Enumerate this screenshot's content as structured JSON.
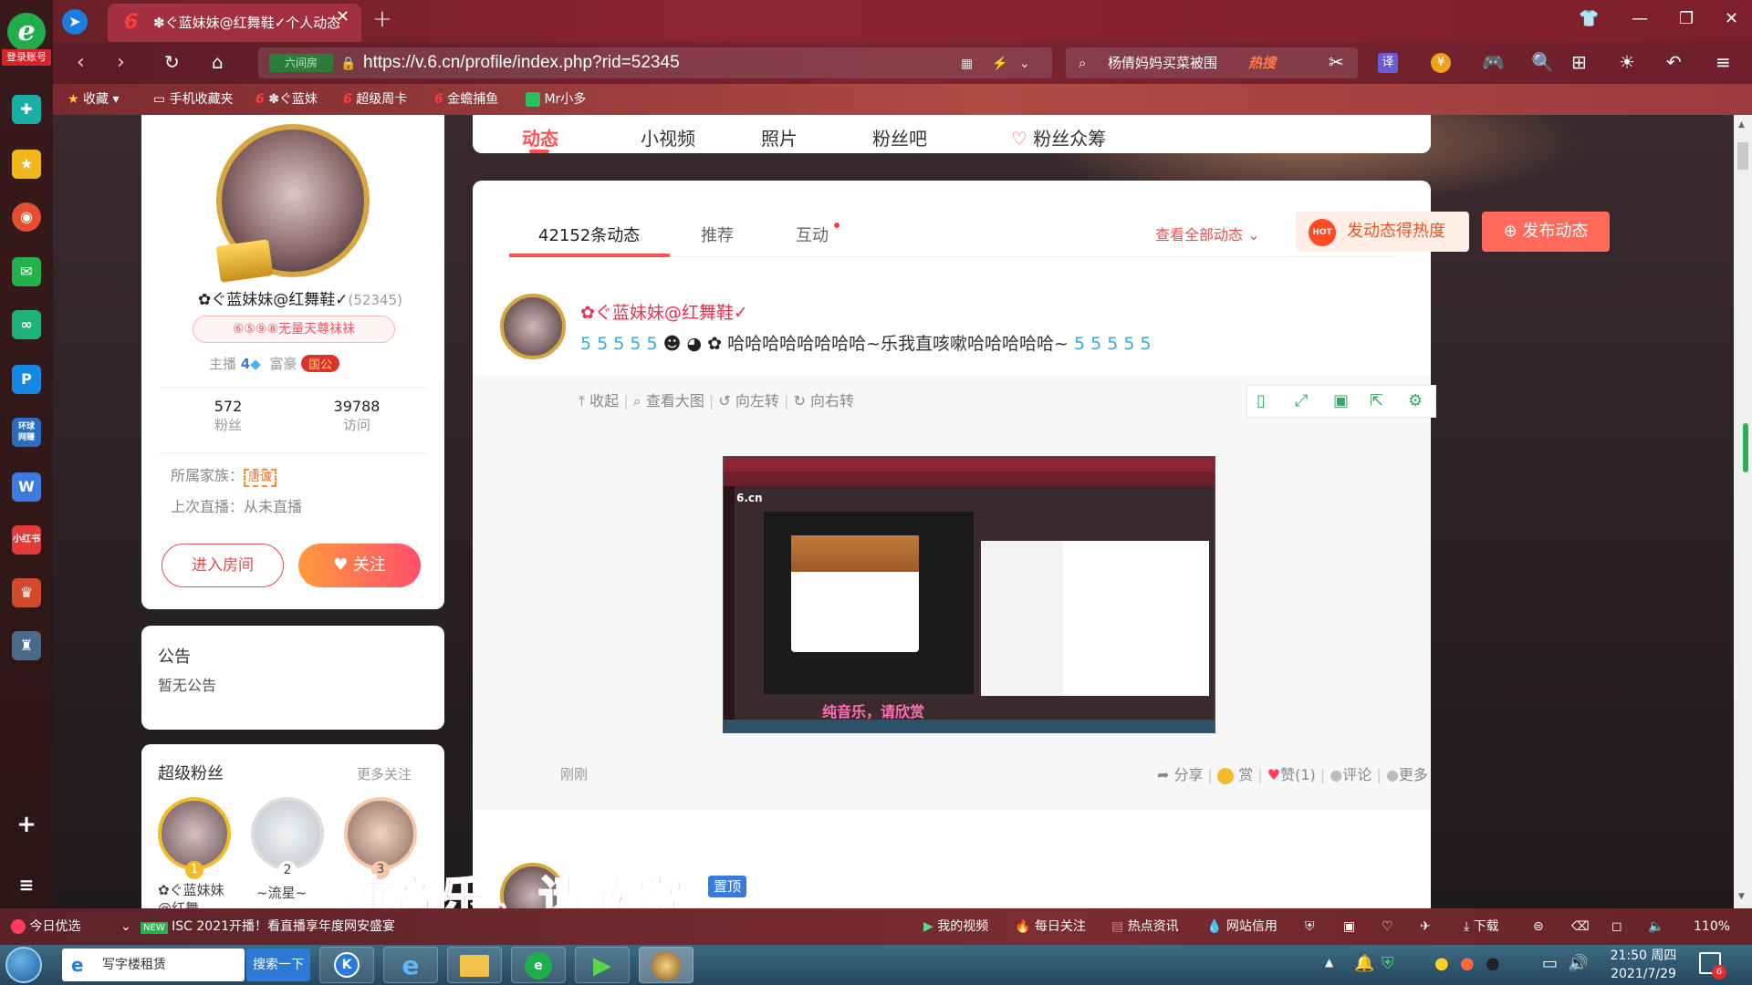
{
  "browser": {
    "login_label": "登录账号",
    "tab_title": "✽ぐ蓝妹妹@红舞鞋✓个人动态",
    "url": "https://v.6.cn/profile/index.php?rid=52345",
    "site_badge": "六间房",
    "search_text": "杨倩妈妈买菜被围",
    "search_hot": "热搜",
    "translate_label": "译",
    "bookmarks": [
      "收藏",
      "手机收藏夹",
      "✽ぐ蓝妹",
      "超级周卡",
      "金蟾捕鱼",
      "Mr小多"
    ]
  },
  "profile_nav": {
    "tabs": [
      "动态",
      "小视频",
      "照片",
      "粉丝吧",
      "粉丝众筹"
    ],
    "active": "动态"
  },
  "profile": {
    "name": "✿ぐ蓝妹妹@红舞鞋✓",
    "rid": "(52345)",
    "badge": "⑥⑤⑨⑧无量天尊袜袜",
    "anchor_label": "主播",
    "anchor_level": "4",
    "rich_label": "富豪",
    "rich_badge": "国公",
    "fans_count": "572",
    "fans_label": "粉丝",
    "visits_count": "39788",
    "visits_label": "访问",
    "family_label": "所属家族：",
    "family_value": "唐诚",
    "last_live": "上次直播：从未直播",
    "enter_room": "进入房间",
    "follow": "关注"
  },
  "notice": {
    "title": "公告",
    "content": "暂无公告"
  },
  "super_fans": {
    "title": "超级粉丝",
    "more": "更多关注",
    "fans": [
      {
        "rank": "1",
        "name": "✿ぐ蓝妹妹@红舞"
      },
      {
        "rank": "2",
        "name": "~流星~"
      },
      {
        "rank": "3",
        "name": ""
      }
    ]
  },
  "feed_header": {
    "count_tab": "42152条动态",
    "recommend_tab": "推荐",
    "interact_tab": "互动",
    "view_all": "查看全部动态",
    "hot_button": "发动态得热度",
    "hot_badge": "HOT",
    "publish_button": "发布动态"
  },
  "post": {
    "author": "✿ぐ蓝妹妹@红舞鞋✓",
    "text": "哈哈哈哈哈哈哈哈~乐我直咳嗽哈哈哈哈哈~",
    "actions": [
      "收起",
      "查看大图",
      "向左转",
      "向右转"
    ],
    "time": "刚刚",
    "footer": [
      "分享",
      "赏",
      "赞(1)",
      "评论",
      "更多"
    ],
    "caption": "纯音乐，请欣赏",
    "screenshot_cn": "6.cn"
  },
  "next_post": {
    "pin": "置顶"
  },
  "infobar": {
    "left": "今日优选",
    "news_tag": "NEW",
    "news": "ISC 2021开播！看直播享年度网安盛宴",
    "items": [
      "我的视频",
      "每日关注",
      "热点资讯",
      "网站信用",
      "下载"
    ],
    "zoom": "110%"
  },
  "taskbar": {
    "ie_text": "写字楼租赁",
    "search_btn": "搜索一下",
    "time": "21:50 周四",
    "date": "2021/7/29",
    "badge": "6"
  },
  "overlay_caption": "纯音乐，请欣赏"
}
